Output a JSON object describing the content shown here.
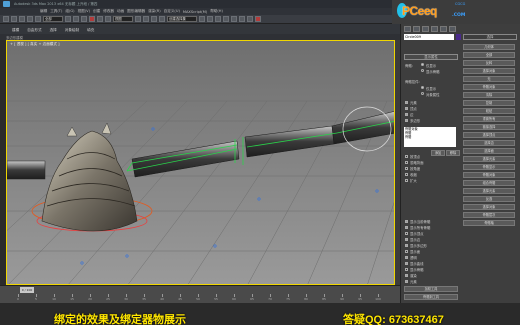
{
  "window": {
    "title": "Autodesk 3ds Max 2013 x64  无标题  上升段 / 第四",
    "menu": [
      "编辑",
      "工具(T)",
      "组(G)",
      "视图(V)",
      "创建",
      "修改器",
      "动画",
      "图形编辑器",
      "渲染(R)",
      "自定义(U)",
      "MAXScript(M)",
      "帮助(H)"
    ]
  },
  "toolbar": {
    "selection_filter": "全部",
    "reference_coord": "视图",
    "named_set": "创建选择集"
  },
  "logo": {
    "main": "PCeeq",
    "sub": "CGCG",
    "com": ".COM"
  },
  "ribbon": {
    "tabs": [
      "建模",
      "自由形式",
      "选择",
      "对象绘制",
      "填充"
    ],
    "sub_label": "多边形建模"
  },
  "viewport": {
    "label": "+ [ 透视 ] [ 真实 + 边面模式 ]"
  },
  "panel": {
    "object_name": "Circle009",
    "selection_header": "选择",
    "display_rollout": "显示属性",
    "display_label": "骨骼:",
    "display_opt1": "仅显示",
    "display_opt2": "显示骨骼",
    "bones_label": "骨骼控件:",
    "bones_opt1": "仅显示",
    "bones_opt2": "对象属性",
    "list_items": [
      "骨骼对象",
      "骨骼",
      "骨骼"
    ],
    "add_btn": "添加",
    "remove_btn": "移除",
    "checkbox_items": [
      "元素",
      "顶点",
      "边",
      "多边形",
      "按顶点",
      "忽略背面",
      "按角度",
      "收缩",
      "扩大"
    ],
    "right_buttons": [
      "几何体",
      "全部",
      "反转",
      "选择对象",
      "无",
      "骨骼对象",
      "清除",
      "复制",
      "粘贴",
      "重置所有",
      "链接选择",
      "选择顶点",
      "选择边",
      "选择面",
      "选择元素",
      "骨骼显示",
      "骨骼对象",
      "组合骨骼",
      "选择元素",
      "反选",
      "选择对象",
      "骨骼层次",
      "骨骼轴"
    ],
    "lower_checkboxes": [
      "显示当前骨骼",
      "显示所有骨骼",
      "显示顶点",
      "显示边",
      "显示多边形",
      "显示面",
      "透明",
      "显示曲线",
      "显示骨骼",
      "渲染",
      "元素"
    ],
    "lower_buttons": [
      "加权工具",
      "骨骼到工具",
      "颜色管理"
    ]
  },
  "timeline": {
    "slider": "0 / 100",
    "ticks": [
      "0",
      "5",
      "10",
      "15",
      "20",
      "25",
      "30",
      "35",
      "40",
      "45",
      "50",
      "55",
      "60",
      "65",
      "70",
      "75",
      "80",
      "85",
      "90",
      "95",
      "100"
    ]
  },
  "captions": {
    "left": "绑定的效果及绑定器物展示",
    "right": "答疑QQ: 673637467"
  }
}
